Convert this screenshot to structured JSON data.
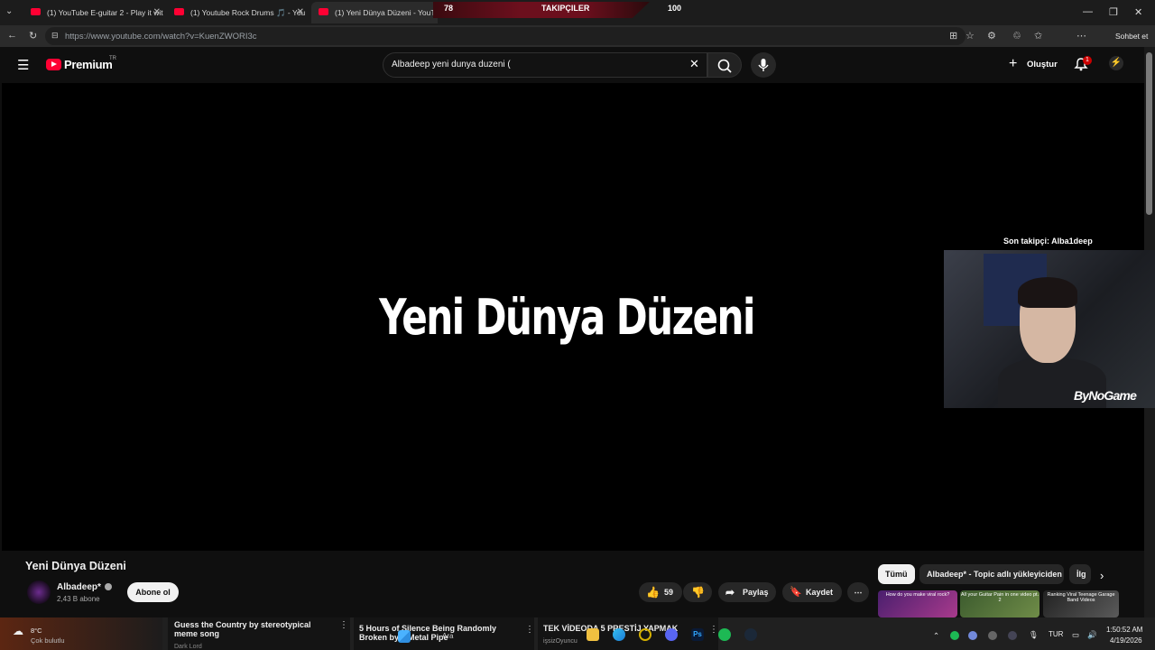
{
  "browser": {
    "tabs": [
      {
        "label": "(1) YouTube E-guitar 2 - Play it wit"
      },
      {
        "label": "(1) Youtube Rock Drums 🎵 - You"
      },
      {
        "label": "(1) Yeni Dünya Düzeni - YouTube"
      }
    ],
    "overlay": {
      "left_count": "78",
      "center_label": "TAKIPÇILER",
      "right_count": "100"
    },
    "url": "https://www.youtube.com/watch?v=KuenZWORI3c",
    "copilot_label": "Sohbet et"
  },
  "youtube": {
    "logo_text": "Premium",
    "logo_region": "TR",
    "search_value": "Albadeep yeni dunya duzeni (",
    "create_label": "Oluştur",
    "notification_count": "1"
  },
  "video": {
    "on_screen_title": "Yeni Dünya Düzeni",
    "stream_overlay": {
      "last_follower": "Son takipçi: Alba1deep",
      "brand": "ByNoGame"
    }
  },
  "details": {
    "title": "Yeni Dünya Düzeni",
    "channel_name": "Albadeep*",
    "subscribers": "2,43 B abone",
    "subscribe_label": "Abone ol",
    "like_count": "59",
    "share_label": "Paylaş",
    "save_label": "Kaydet"
  },
  "related": {
    "chips": [
      "Tümü",
      "Albadeep* - Topic adlı yükleyiciden",
      "İlg"
    ],
    "thumbs": [
      "How do you make viral rock?",
      "All your Guitar Pain in one video pt. 2",
      "Ranking Viral Teenage Garage Band Videos"
    ]
  },
  "taskbar": {
    "weather_temp": "8°C",
    "weather_desc": "Çok bulutlu",
    "item1_title": "Guess the Country by stereotypical meme song",
    "item1_sub": "Dark Lord",
    "item2_title": "5 Hours of Silence Being Randomly Broken by a Metal Pipe",
    "search_label": "Ara",
    "item3_title": "TEK VİDEODA 5 PRESTİJ YAPMAK",
    "item3_sub": "işsizOyuncu",
    "lang": "TUR",
    "time": "1:50:52 AM",
    "date": "4/19/2026"
  },
  "colors": {
    "youtube_red": "#ff0033",
    "background": "#0f0f0f",
    "overlay_red": "#6c0f1d"
  }
}
